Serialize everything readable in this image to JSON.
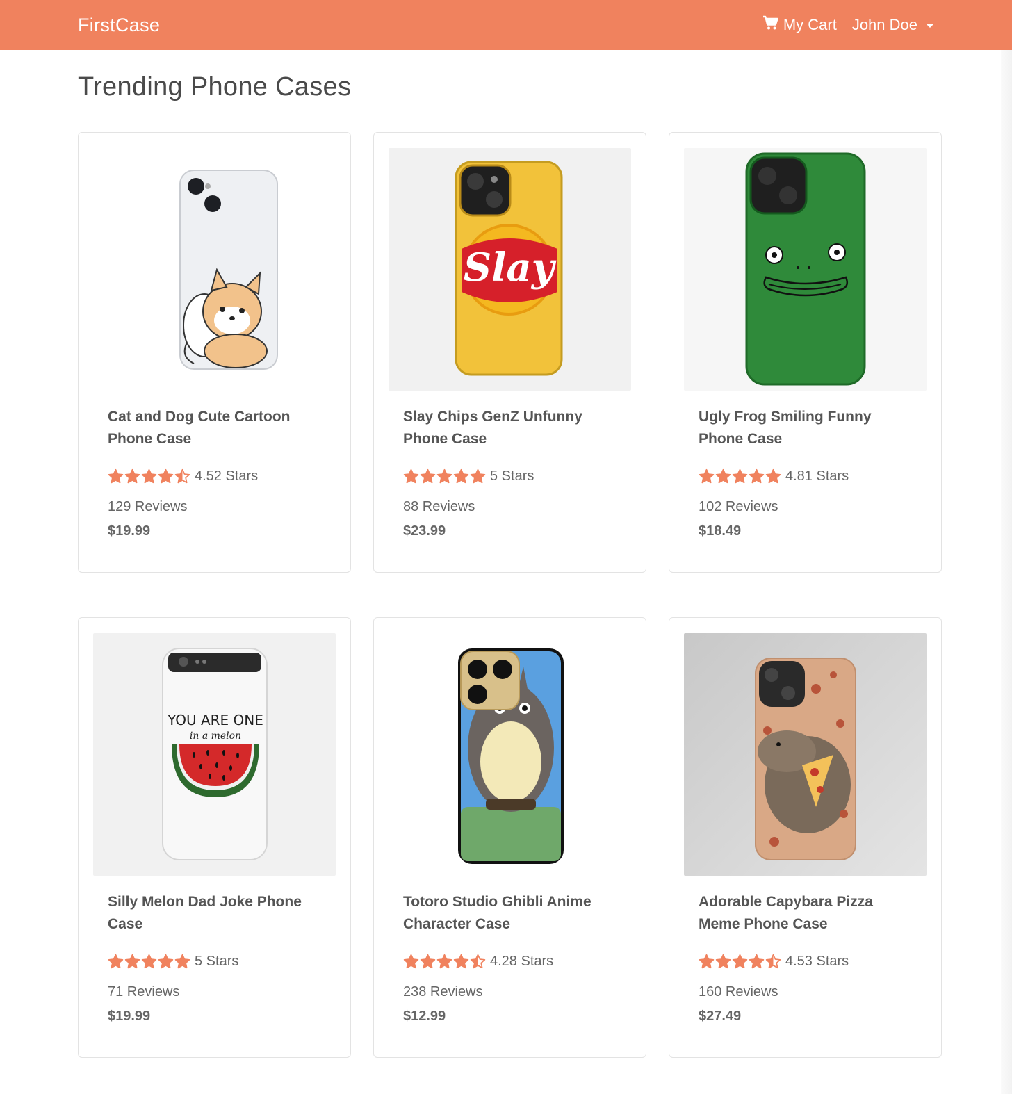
{
  "nav": {
    "brand": "FirstCase",
    "cart_label": "My Cart",
    "user_label": "John Doe"
  },
  "page": {
    "title": "Trending Phone Cases"
  },
  "colors": {
    "accent": "#f0825e",
    "star": "#f0825e"
  },
  "products": [
    {
      "title": "Cat and Dog Cute Cartoon Phone Case",
      "rating": 4.52,
      "rating_label": "4.52 Stars",
      "reviews": "129 Reviews",
      "price": "$19.99",
      "art": "cat-dog"
    },
    {
      "title": "Slay Chips GenZ Unfunny Phone Case",
      "rating": 5,
      "rating_label": "5 Stars",
      "reviews": "88 Reviews",
      "price": "$23.99",
      "art": "slay",
      "art_text": "Slay"
    },
    {
      "title": "Ugly Frog Smiling Funny Phone Case",
      "rating": 4.81,
      "rating_label": "4.81 Stars",
      "reviews": "102 Reviews",
      "price": "$18.49",
      "art": "frog"
    },
    {
      "title": "Silly Melon Dad Joke Phone Case",
      "rating": 5,
      "rating_label": "5 Stars",
      "reviews": "71 Reviews",
      "price": "$19.99",
      "art": "melon",
      "art_text": "YOU ARE ONE",
      "art_subtext": "in a melon"
    },
    {
      "title": "Totoro Studio Ghibli Anime Character Case",
      "rating": 4.28,
      "rating_label": "4.28 Stars",
      "reviews": "238 Reviews",
      "price": "$12.99",
      "art": "totoro"
    },
    {
      "title": "Adorable Capybara Pizza Meme Phone Case",
      "rating": 4.53,
      "rating_label": "4.53 Stars",
      "reviews": "160 Reviews",
      "price": "$27.49",
      "art": "capybara"
    }
  ]
}
